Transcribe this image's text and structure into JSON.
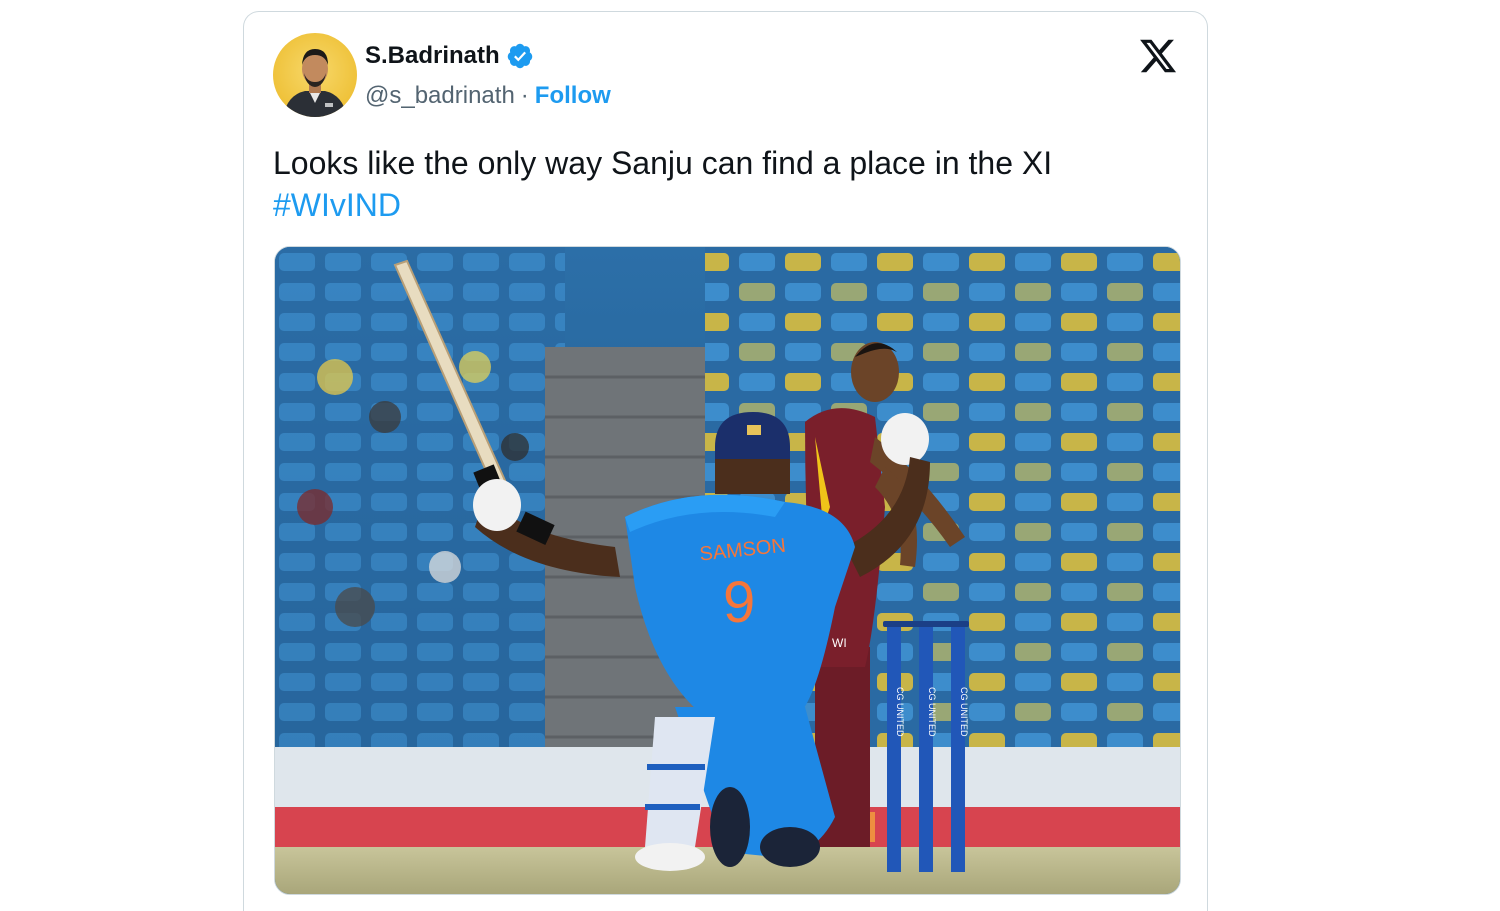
{
  "tweet": {
    "author": {
      "name": "S.Badrinath",
      "handle": "@s_badrinath",
      "verified": true,
      "avatar_icon": "profile-photo"
    },
    "separator": "·",
    "follow_label": "Follow",
    "platform_icon": "x-logo-icon",
    "text": "Looks like the only way Sanju can find a place in the XI",
    "hashtag": "#WIvIND",
    "media": {
      "jersey_name": "SAMSON",
      "jersey_number": "9",
      "stump_sponsor": "CG UNITED"
    }
  },
  "colors": {
    "link": "#1d9bf0",
    "text": "#0f1419",
    "secondary_text": "#536471",
    "border": "#cfd9de",
    "jersey_blue": "#1e88e5",
    "wi_maroon": "#7a1f2b"
  }
}
